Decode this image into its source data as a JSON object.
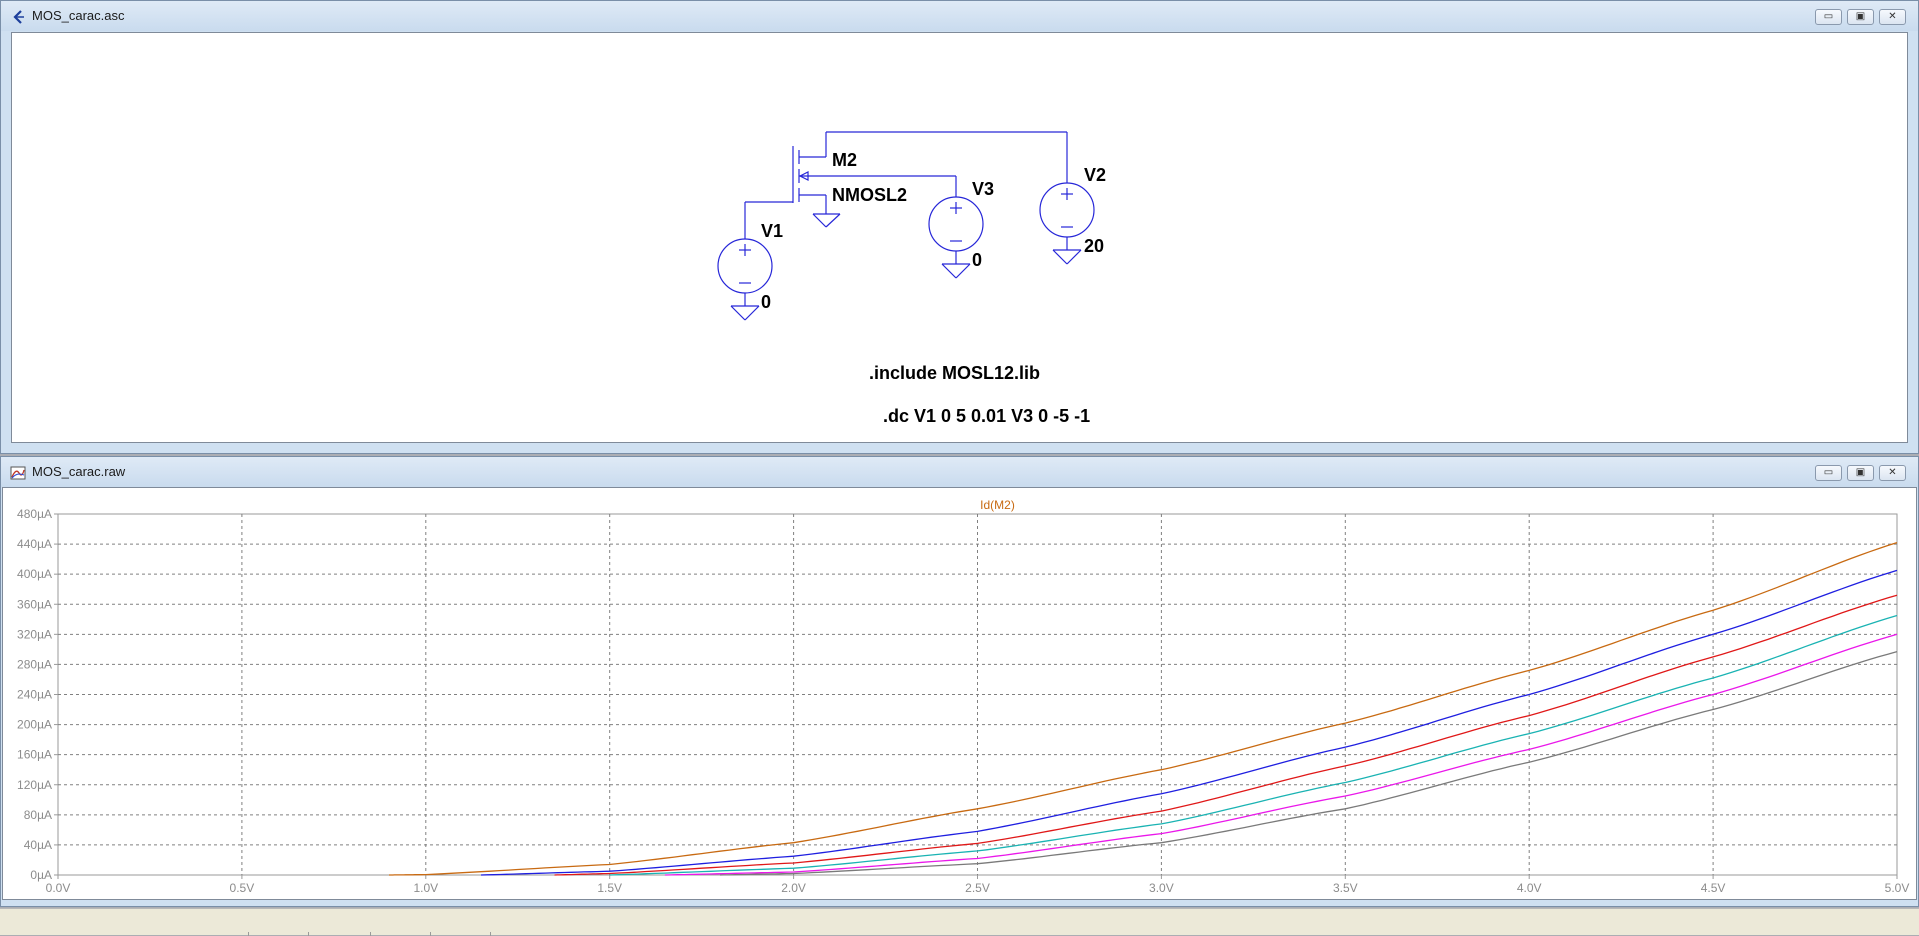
{
  "windows": {
    "schematic": {
      "title": "MOS_carac.asc",
      "controls": [
        "▭",
        "▣",
        "✕"
      ]
    },
    "waveform": {
      "title": "MOS_carac.raw",
      "controls": [
        "▭",
        "▣",
        "✕"
      ]
    }
  },
  "schematic": {
    "components": {
      "m2": {
        "name": "M2",
        "model": "NMOSL2"
      },
      "v1": {
        "name": "V1",
        "value": "0"
      },
      "v3": {
        "name": "V3",
        "value": "0"
      },
      "v2": {
        "name": "V2",
        "value": "20"
      }
    },
    "directives": [
      ".include MOSL12.lib",
      ".dc V1 0 5 0.01 V3 0 -5 -1"
    ]
  },
  "chart_data": {
    "type": "line",
    "title": "Id(M2)",
    "xlabel": "",
    "ylabel": "",
    "xlim": [
      0,
      5
    ],
    "ylim": [
      0,
      480
    ],
    "x_unit": "V",
    "y_unit": "µA",
    "xticks": [
      "0.0V",
      "0.5V",
      "1.0V",
      "1.5V",
      "2.0V",
      "2.5V",
      "3.0V",
      "3.5V",
      "4.0V",
      "4.5V",
      "5.0V"
    ],
    "yticks": [
      "0µA",
      "40µA",
      "80µA",
      "120µA",
      "160µA",
      "200µA",
      "240µA",
      "280µA",
      "320µA",
      "360µA",
      "400µA",
      "440µA",
      "480µA"
    ],
    "grid": true,
    "grid_style": "dashed",
    "title_color": "#c86a12",
    "series": [
      {
        "color": "#c86a12",
        "threshold": 0.9,
        "x": [
          0.9,
          1.0,
          1.5,
          2.0,
          2.5,
          3.0,
          3.5,
          4.0,
          4.5,
          5.0
        ],
        "values": [
          0,
          0.5,
          14,
          43,
          88,
          140,
          202,
          272,
          352,
          442
        ]
      },
      {
        "color": "#1f1fe0",
        "threshold": 1.15,
        "x": [
          1.15,
          1.5,
          2.0,
          2.5,
          3.0,
          3.5,
          4.0,
          4.5,
          5.0
        ],
        "values": [
          0,
          5,
          25,
          58,
          108,
          170,
          240,
          320,
          405
        ]
      },
      {
        "color": "#e01818",
        "threshold": 1.35,
        "x": [
          1.35,
          1.5,
          2.0,
          2.5,
          3.0,
          3.5,
          4.0,
          4.5,
          5.0
        ],
        "values": [
          0,
          2,
          16,
          42,
          85,
          145,
          212,
          290,
          372
        ]
      },
      {
        "color": "#1ab3b3",
        "threshold": 1.5,
        "x": [
          1.5,
          2.0,
          2.5,
          3.0,
          3.5,
          4.0,
          4.5,
          5.0
        ],
        "values": [
          0,
          9,
          32,
          68,
          123,
          188,
          262,
          345
        ]
      },
      {
        "color": "#ea18ea",
        "threshold": 1.65,
        "x": [
          1.65,
          2.0,
          2.5,
          3.0,
          3.5,
          4.0,
          4.5,
          5.0
        ],
        "values": [
          0,
          4,
          22,
          55,
          105,
          167,
          240,
          320
        ]
      },
      {
        "color": "#7a7a7a",
        "threshold": 1.8,
        "x": [
          1.8,
          2.0,
          2.5,
          3.0,
          3.5,
          4.0,
          4.5,
          5.0
        ],
        "values": [
          0,
          2,
          15,
          43,
          88,
          150,
          220,
          297
        ]
      }
    ]
  },
  "colors": {
    "wire": "#2727d8",
    "plot_bg": "#ffffff",
    "grid": "#808080",
    "axis_text": "#8c8c8c"
  }
}
